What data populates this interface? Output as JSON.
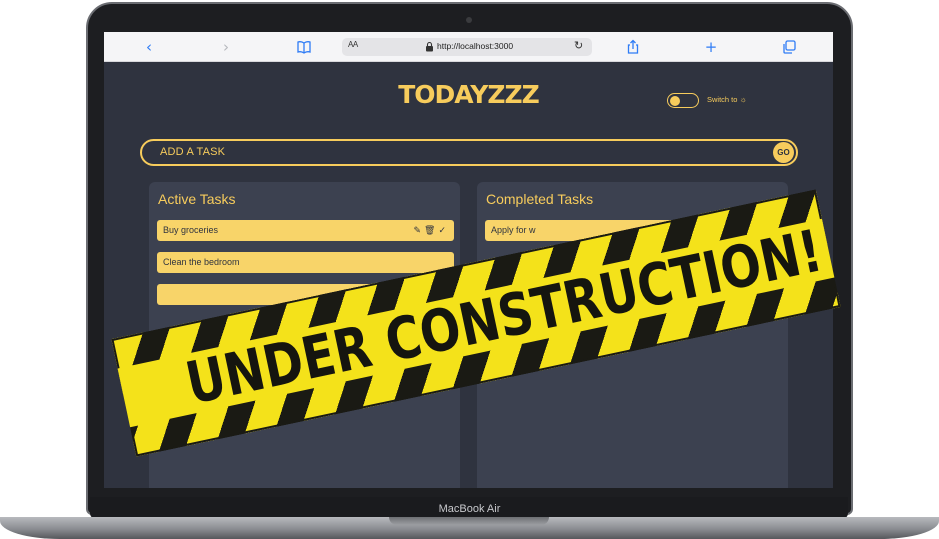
{
  "device": {
    "label": "MacBook Air"
  },
  "browser": {
    "reader_label": "AA",
    "url": "http://localhost:3000",
    "icons": [
      "back-icon",
      "forward-icon",
      "book-icon",
      "lock-icon",
      "reload-icon",
      "share-icon",
      "plus-icon",
      "tabs-icon"
    ]
  },
  "app": {
    "title": "TODAYZZZ",
    "theme_toggle": {
      "label": "Switch to",
      "icon": "sun-icon",
      "icon_glyph": "☼",
      "checked": false
    },
    "task_input": {
      "placeholder": "ADD A TASK",
      "button_label": "GO"
    },
    "active": {
      "title": "Active Tasks",
      "tasks": [
        {
          "label": "Buy groceries",
          "actions": [
            "pencil-icon",
            "trash-icon",
            "check-icon"
          ]
        },
        {
          "label": "Clean the bedroom"
        },
        {
          "label": ""
        }
      ]
    },
    "completed": {
      "title": "Completed Tasks",
      "tasks": [
        {
          "label": "Apply for w"
        }
      ]
    }
  },
  "overlay": {
    "text": "UNDER CONSTRUCTION!"
  },
  "colors": {
    "accent": "#f7cc5c",
    "background": "#2f333f",
    "panel": "#3c4150",
    "banner_yellow": "#f4e21a",
    "banner_black": "#1a1a14"
  }
}
